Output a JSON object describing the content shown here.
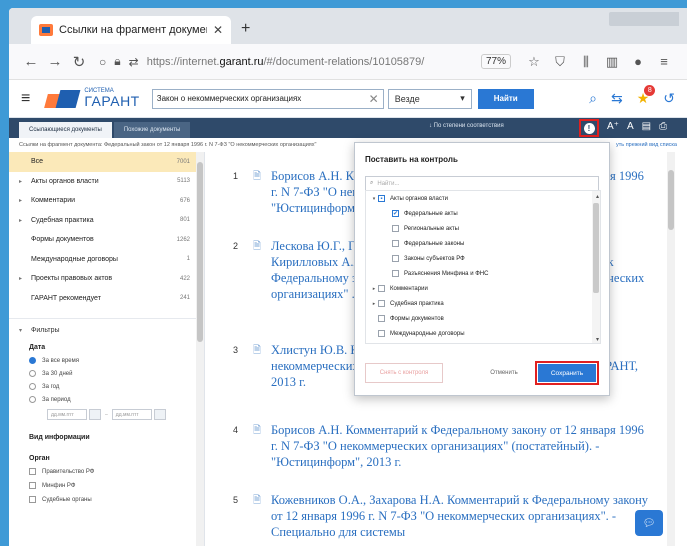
{
  "browser": {
    "tab_title": "Ссылки на фрагмент докумен",
    "url_prefix": "https://internet.",
    "url_domain": "garant.ru",
    "url_rest": "/#/document-relations/10105879/",
    "zoom": "77%"
  },
  "header": {
    "logo_small": "СИСТЕМА",
    "logo_big": "ГАРАНТ",
    "search_value": "Закон о некоммерческих организациях",
    "scope_value": "Везде",
    "find_label": "Найти",
    "notification_count": "8"
  },
  "doc_tabs": {
    "tab1": "Ссылающиеся документы",
    "tab2": "Похожие документы",
    "sort_label": "↓  По степени соответствия"
  },
  "breadcrumb": {
    "text": "Ссылки на фрагмент документа: Федеральный закон от 12 января 1996 г. N 7-ФЗ \"О некоммерческих организациях\"",
    "link": "уть прежний вид списка"
  },
  "sidebar": {
    "categories": [
      {
        "name": "Все",
        "count": "7001",
        "arrow": ""
      },
      {
        "name": "Акты органов власти",
        "count": "5113",
        "arrow": "▸"
      },
      {
        "name": "Комментарии",
        "count": "676",
        "arrow": "▸"
      },
      {
        "name": "Судебная практика",
        "count": "801",
        "arrow": "▸"
      },
      {
        "name": "Формы документов",
        "count": "1262",
        "arrow": ""
      },
      {
        "name": "Международные договоры",
        "count": "1",
        "arrow": ""
      },
      {
        "name": "Проекты правовых актов",
        "count": "422",
        "arrow": "▸"
      },
      {
        "name": "ГАРАНТ рекомендует",
        "count": "241",
        "arrow": ""
      }
    ],
    "filters_label": "Фильтры",
    "date_label": "Дата",
    "date_options": [
      "За все время",
      "За 30 дней",
      "За год",
      "За период"
    ],
    "date_from_placeholder": "дд.мм.гггг",
    "date_to_placeholder": "дд.мм.гггг",
    "info_type_label": "Вид информации",
    "organ_label": "Орган",
    "organs": [
      "Правительство РФ",
      "Минфин РФ",
      "Судебные органы"
    ]
  },
  "results": [
    {
      "num": "1",
      "text": "Борисов А.Н. Комментарий к Федеральному закону от 12 января 1996 г. N 7-ФЗ \"О некоммерческих организациях\" (постатейный). - \"Юстицинформ\", 2018 г."
    },
    {
      "num": "2",
      "text": "Лескова Ю.Г., Гаврилов Д.А., Кирилловых А.А., Павлова К.П., Кирилловых А.А., Хлистун Ю.В., Тимошенко ... Комментарий к Федеральному закону от 12 января 1996 г. N 7-ФЗ \"О некоммерческих организациях\" ... 8 г."
    },
    {
      "num": "3",
      "text": "Хлистун Ю.В. Комментарий к Федеральному закону \"О некоммерческих организациях\". - Специально для системы ГАРАНТ, 2013 г."
    },
    {
      "num": "4",
      "text": "Борисов А.Н. Комментарий к Федеральному закону от 12 января 1996 г. N 7-ФЗ \"О некоммерческих организациях\" (постатейный). - \"Юстицинформ\", 2013 г."
    },
    {
      "num": "5",
      "text": "Кожевников О.А., Захарова Н.А. Комментарий к Федеральному закону от 12 января 1996 г. N 7-ФЗ \"О некоммерческих организациях\". - Специально для системы"
    }
  ],
  "modal": {
    "title": "Поставить на контроль",
    "search_placeholder": "Найти...",
    "items": [
      {
        "label": "Акты органов власти",
        "level": 0,
        "twisty": "▾",
        "checked": "partial"
      },
      {
        "label": "Федеральные акты",
        "level": 1,
        "twisty": "",
        "checked": "yes"
      },
      {
        "label": "Региональные акты",
        "level": 1,
        "twisty": "",
        "checked": "no"
      },
      {
        "label": "Федеральные законы",
        "level": 1,
        "twisty": "",
        "checked": "no"
      },
      {
        "label": "Законы субъектов РФ",
        "level": 1,
        "twisty": "",
        "checked": "no"
      },
      {
        "label": "Разъяснения Минфина и ФНС",
        "level": 1,
        "twisty": "",
        "checked": "no"
      },
      {
        "label": "Комментарии",
        "level": 0,
        "twisty": "▸",
        "checked": "no"
      },
      {
        "label": "Судебная практика",
        "level": 0,
        "twisty": "▸",
        "checked": "no"
      },
      {
        "label": "Формы документов",
        "level": 0,
        "twisty": "",
        "checked": "no"
      },
      {
        "label": "Международные договоры",
        "level": 0,
        "twisty": "",
        "checked": "no"
      }
    ],
    "remove_label": "Снять с контроля",
    "cancel_label": "Отменить",
    "save_label": "Сохранить"
  }
}
